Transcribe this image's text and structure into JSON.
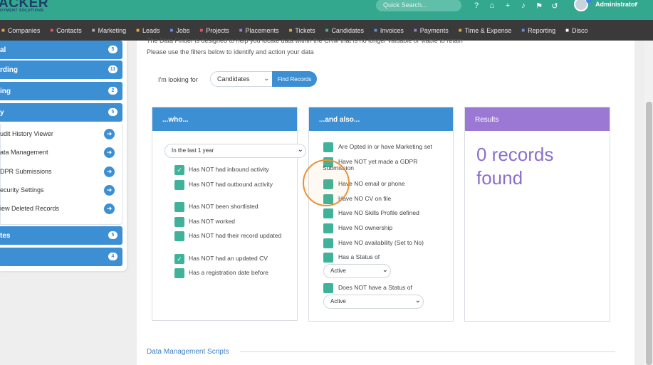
{
  "app": {
    "logo_text": "ACKER",
    "logo_sub": "OYMENT SOLUTIONS",
    "quick_search_placeholder": "Quick Search...",
    "user_name": "Administrator"
  },
  "nav": [
    {
      "label": "Companies",
      "icon": "building-icon",
      "color": "#e8a23a"
    },
    {
      "label": "Contacts",
      "icon": "contacts-icon",
      "color": "#e25555"
    },
    {
      "label": "Marketing",
      "icon": "marketing-icon",
      "color": "#aaaaaa"
    },
    {
      "label": "Leads",
      "icon": "leads-icon",
      "color": "#e8a23a"
    },
    {
      "label": "Jobs",
      "icon": "jobs-icon",
      "color": "#5b8fe0"
    },
    {
      "label": "Projects",
      "icon": "projects-icon",
      "color": "#e25555"
    },
    {
      "label": "Placements",
      "icon": "placements-icon",
      "color": "#9a78d4"
    },
    {
      "label": "Tickets",
      "icon": "tickets-icon",
      "color": "#e8a23a"
    },
    {
      "label": "Candidates",
      "icon": "candidates-icon",
      "color": "#40b29a"
    },
    {
      "label": "Invoices",
      "icon": "invoices-icon",
      "color": "#5b8fe0"
    },
    {
      "label": "Payments",
      "icon": "payments-icon",
      "color": "#9a78d4"
    },
    {
      "label": "Time & Expense",
      "icon": "clock-icon",
      "color": "#e8a23a"
    },
    {
      "label": "Reporting",
      "icon": "reporting-icon",
      "color": "#5b8fe0"
    },
    {
      "label": "Disco",
      "icon": "search-icon",
      "color": "#ffffff"
    }
  ],
  "sidebar": {
    "sections": [
      {
        "label": "al",
        "count": "5"
      },
      {
        "label": "rding",
        "count": "11"
      },
      {
        "label": "ing",
        "count": "2"
      },
      {
        "label": "y",
        "count": "5"
      }
    ],
    "sub_items": [
      {
        "label": "udit History Viewer"
      },
      {
        "label": "ata Management"
      },
      {
        "label": "DPR Submissions"
      },
      {
        "label": "ecurity Settings"
      },
      {
        "label": "iew Deleted Records"
      }
    ],
    "bottom_sections": [
      {
        "label": "tes",
        "count": "5"
      },
      {
        "label": "",
        "count": "4"
      }
    ]
  },
  "main": {
    "intro_line1": "The Data Finder is designed to help you locate data within the CRM that is no longer valuable or viable to retain",
    "intro_line2": "Please use the filters below to identify and action your data",
    "looking_for_label": "I'm looking for",
    "looking_for_value": "Candidates",
    "find_button": "Find Records",
    "who": {
      "title": "...who...",
      "period": "In the last 1 year",
      "options": [
        {
          "label": "Has NOT had inbound activity",
          "checked": true
        },
        {
          "label": "Has NOT had outbound activity",
          "checked": false
        },
        {
          "label": "Has NOT been shortlisted",
          "checked": false
        },
        {
          "label": "Has NOT worked",
          "checked": false
        },
        {
          "label": "Has NOT had their record updated",
          "checked": false
        },
        {
          "label": "Has NOT had an updated CV",
          "checked": true
        },
        {
          "label": "Has a registration date before",
          "checked": false
        }
      ]
    },
    "also": {
      "title": "...and also...",
      "options": [
        {
          "label": "Are Opted in or have Marketing set",
          "checked": false
        },
        {
          "label": "Have NOT yet made a GDPR Submission",
          "checked": false
        },
        {
          "label": "Have NO email or phone",
          "checked": false
        },
        {
          "label": "Have NO CV on file",
          "checked": false
        },
        {
          "label": "Have NO Skills Profile defined",
          "checked": false
        },
        {
          "label": "Have NO ownership",
          "checked": false
        },
        {
          "label": "Have NO availability (Set to No)",
          "checked": false
        },
        {
          "label": "Has a Status of",
          "checked": false
        },
        {
          "label": "Does NOT have a Status of",
          "checked": false
        }
      ],
      "status_value": "Active",
      "not_status_value": "Active"
    },
    "results": {
      "title": "Results",
      "line1": "0 records",
      "line2": "found"
    },
    "scripts_title": "Data Management Scripts"
  },
  "colors": {
    "topbar": "#34a88f",
    "accent_blue": "#3d8fd4",
    "checkbox_green": "#40b29a",
    "results_purple": "#9a78d4",
    "highlight_orange": "#e6943a"
  }
}
